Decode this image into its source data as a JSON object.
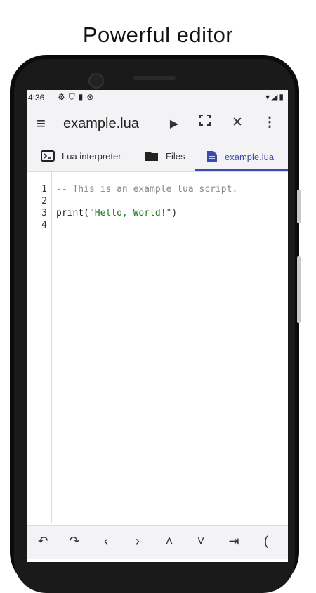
{
  "headline": "Powerful editor",
  "status_bar": {
    "time": "4:36",
    "left_icons": [
      "settings-icon",
      "shield-icon",
      "sim-icon",
      "sync-icon"
    ],
    "right_icons": [
      "wifi-icon",
      "signal-icon",
      "battery-icon"
    ]
  },
  "app_bar": {
    "title": "example.lua",
    "actions": [
      "run",
      "fullscreen",
      "close",
      "more"
    ]
  },
  "tabs": [
    {
      "label": "Lua interpreter",
      "icon": "terminal-icon"
    },
    {
      "label": "Files",
      "icon": "folder-icon"
    },
    {
      "label": "example.lua",
      "icon": "document-icon",
      "selected": true
    }
  ],
  "editor": {
    "line_numbers": [
      "1",
      "2",
      "3",
      "4"
    ],
    "lines": {
      "l1_comment": "-- This is an example lua script.",
      "l3_prefix": "print(",
      "l3_string": "\"Hello, World!\"",
      "l3_suffix": ")"
    }
  },
  "bottom_keys": [
    {
      "name": "undo",
      "glyph": "↶"
    },
    {
      "name": "redo",
      "glyph": "↷"
    },
    {
      "name": "left",
      "glyph": "‹"
    },
    {
      "name": "right",
      "glyph": "›"
    },
    {
      "name": "up",
      "glyph": "˄"
    },
    {
      "name": "down",
      "glyph": "˅"
    },
    {
      "name": "tab",
      "glyph": "⇥"
    },
    {
      "name": "paren",
      "glyph": "("
    }
  ],
  "colors": {
    "accent": "#3b4ab0",
    "string": "#207a20",
    "comment": "#8a8a8a"
  }
}
